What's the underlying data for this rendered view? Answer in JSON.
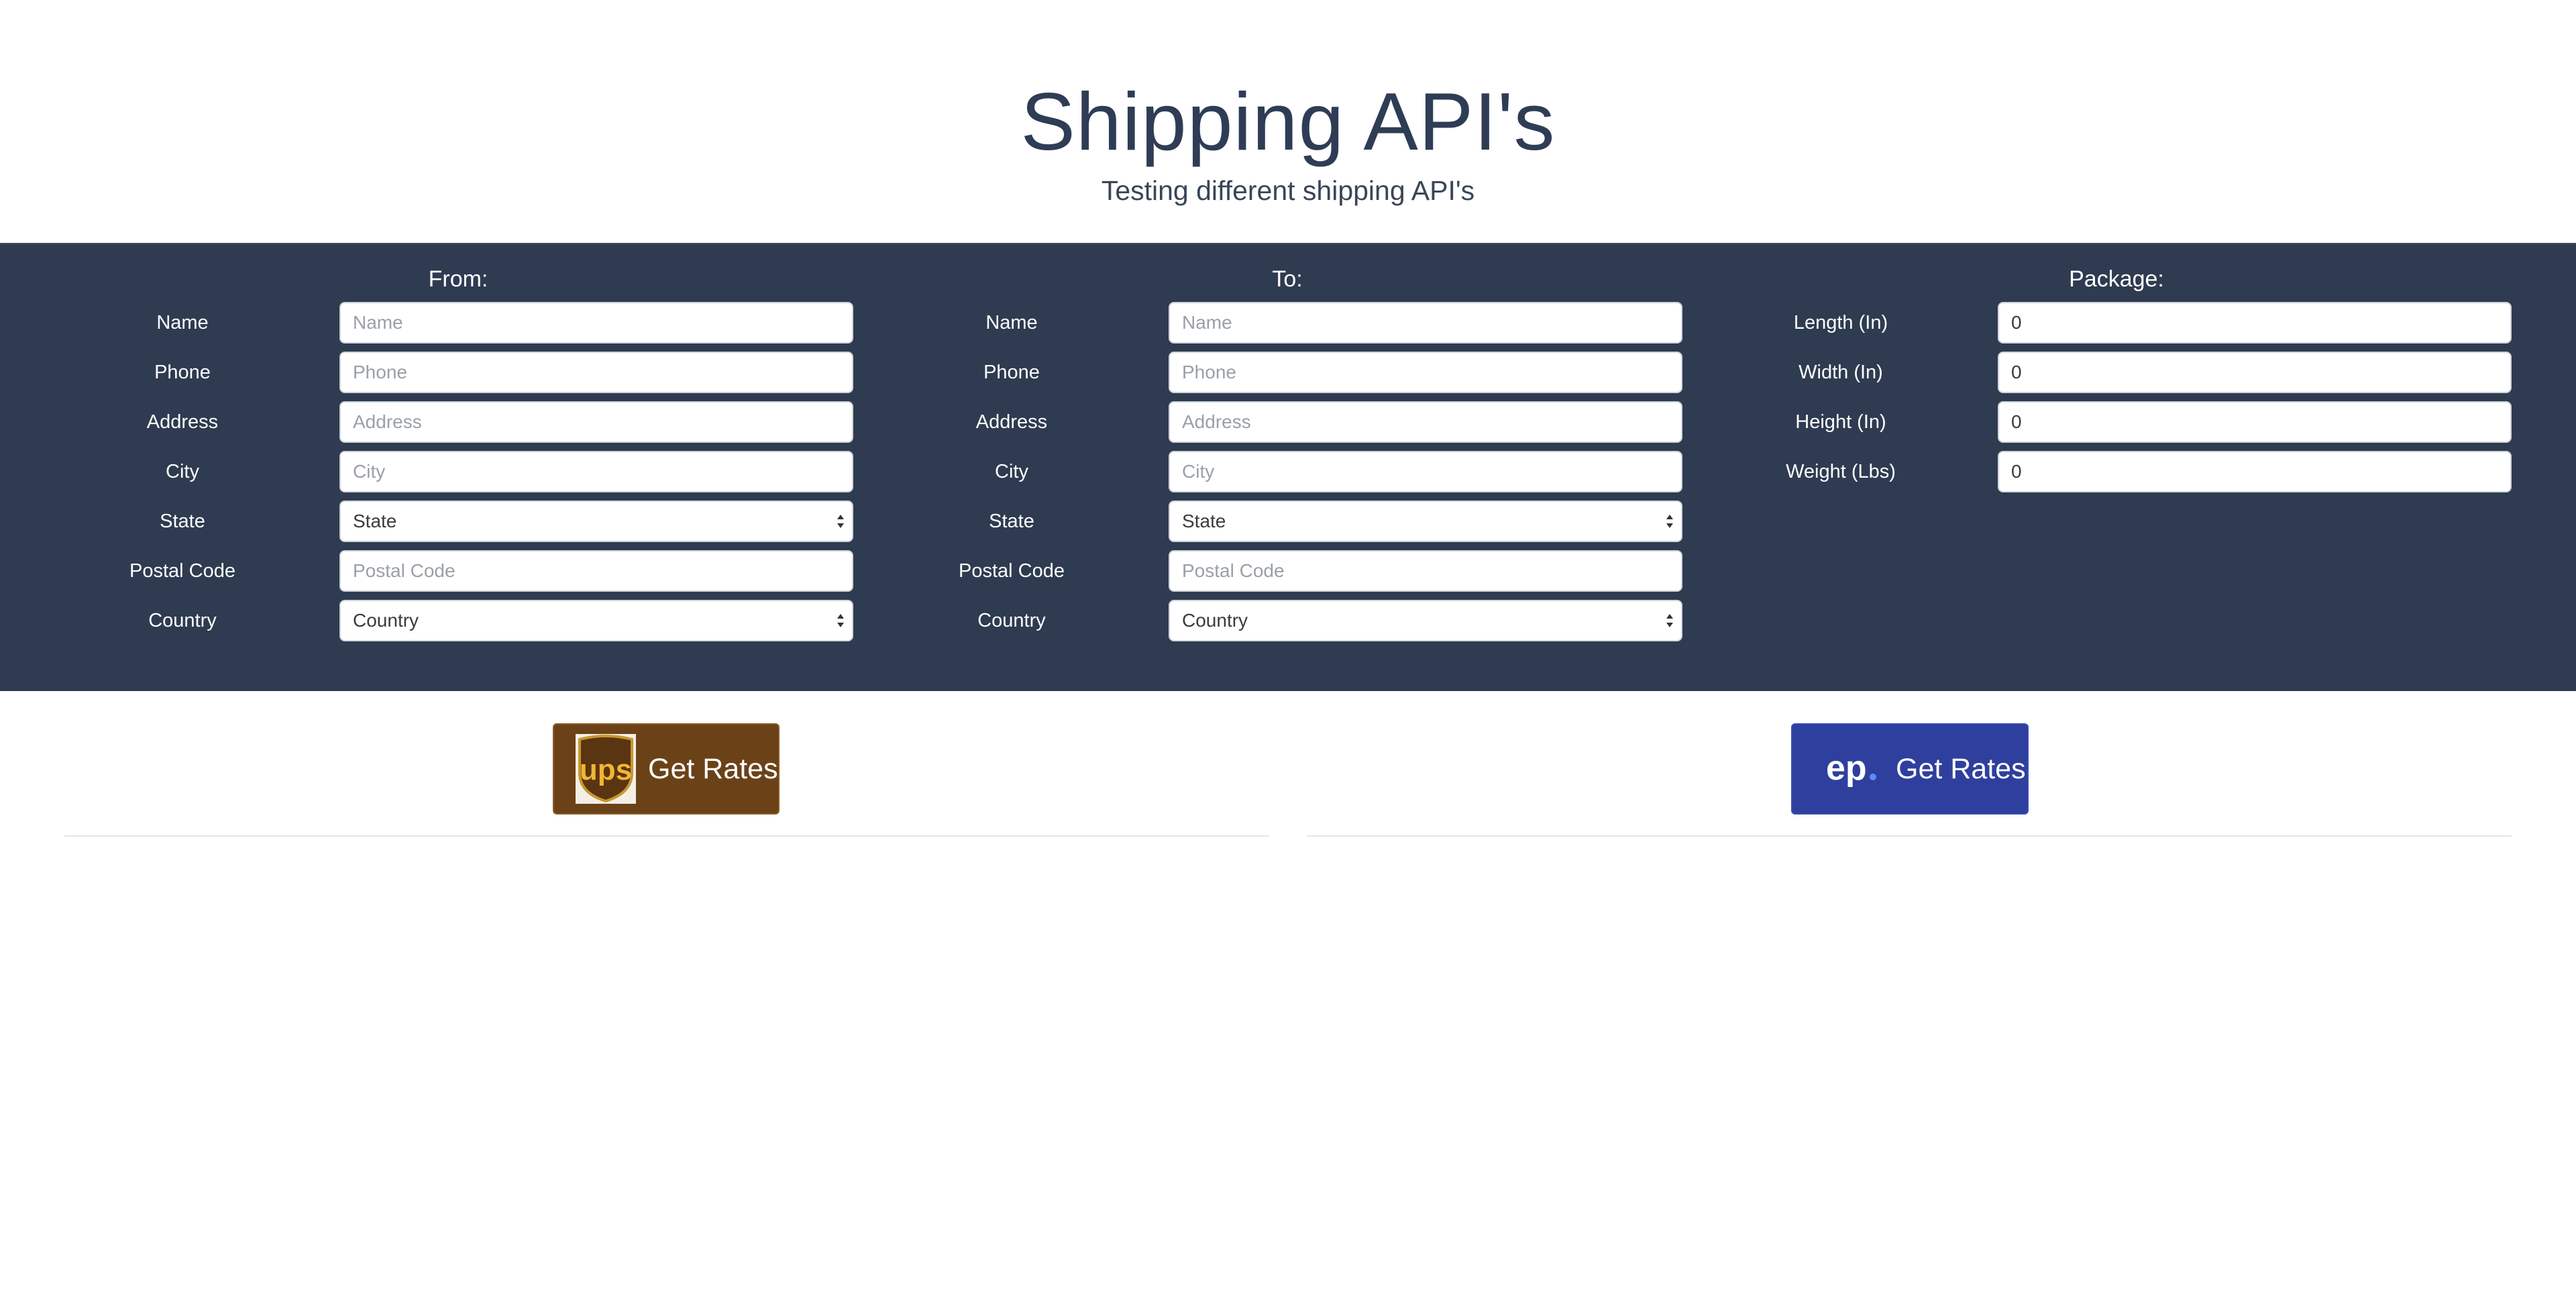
{
  "header": {
    "title": "Shipping API's",
    "subtitle": "Testing different shipping API's"
  },
  "from": {
    "title": "From:",
    "fields": [
      {
        "label": "Name",
        "placeholder": "Name",
        "value": ""
      },
      {
        "label": "Phone",
        "placeholder": "Phone",
        "value": ""
      },
      {
        "label": "Address",
        "placeholder": "Address",
        "value": ""
      },
      {
        "label": "City",
        "placeholder": "City",
        "value": ""
      },
      {
        "label": "State",
        "selected": "State"
      },
      {
        "label": "Postal Code",
        "placeholder": "Postal Code",
        "value": ""
      },
      {
        "label": "Country",
        "selected": "Country"
      }
    ]
  },
  "to": {
    "title": "To:",
    "fields": [
      {
        "label": "Name",
        "placeholder": "Name",
        "value": ""
      },
      {
        "label": "Phone",
        "placeholder": "Phone",
        "value": ""
      },
      {
        "label": "Address",
        "placeholder": "Address",
        "value": ""
      },
      {
        "label": "City",
        "placeholder": "City",
        "value": ""
      },
      {
        "label": "State",
        "selected": "State"
      },
      {
        "label": "Postal Code",
        "placeholder": "Postal Code",
        "value": ""
      },
      {
        "label": "Country",
        "selected": "Country"
      }
    ]
  },
  "package": {
    "title": "Package:",
    "fields": [
      {
        "label": "Length (In)",
        "value": "0"
      },
      {
        "label": "Width (In)",
        "value": "0"
      },
      {
        "label": "Height (In)",
        "value": "0"
      },
      {
        "label": "Weight (Lbs)",
        "value": "0"
      }
    ]
  },
  "actions": {
    "ups_label": "Get Rates",
    "ups_logo_text": "ups",
    "easypost_label": "Get Rates",
    "easypost_logo_text": "ep"
  },
  "colors": {
    "band": "#2e3b50",
    "ups_button": "#6b4218",
    "easypost_button": "#2f3f9e",
    "title_text": "#2e3d55"
  }
}
